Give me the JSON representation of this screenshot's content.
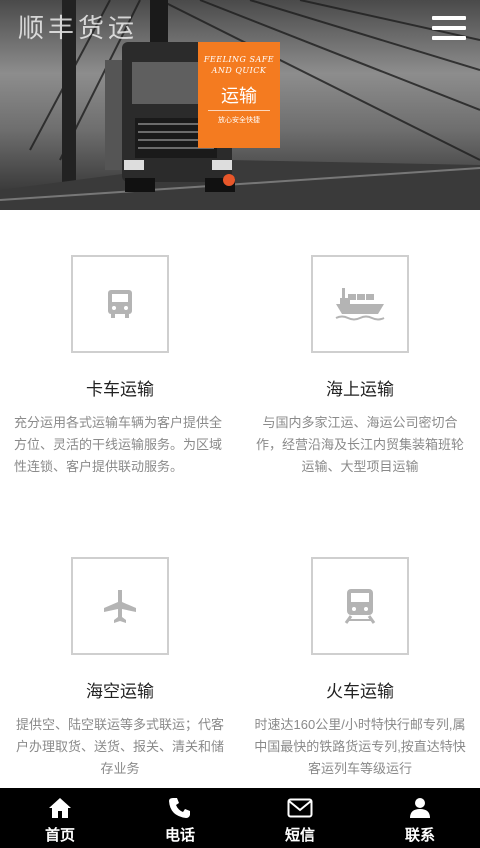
{
  "header": {
    "brand": "顺丰货运",
    "menu_icon": "hamburger-menu-icon"
  },
  "hero": {
    "badge_en": "FEELING SAFE AND QUICK",
    "badge_cn": "运输",
    "badge_sub": "放心安全快捷",
    "accent_color": "#f47b20"
  },
  "services": [
    {
      "title": "卡车运输",
      "icon": "truck-icon",
      "desc": "充分运用各式运输车辆为客户提供全方位、灵活的干线运输服务。为区域性连锁、客户提供联动服务。"
    },
    {
      "title": "海上运输",
      "icon": "ship-icon",
      "desc": "与国内多家江运、海运公司密切合作，经营沿海及长江内贸集装箱班轮运输、大型项目运输"
    },
    {
      "title": "海空运输",
      "icon": "airplane-icon",
      "desc": "提供空、陆空联运等多式联运；代客户办理取货、送货、报关、清关和储存业务"
    },
    {
      "title": "火车运输",
      "icon": "train-icon",
      "desc": "时速达160公里/小时特快行邮专列,属中国最快的铁路货运专列,按直达特快客运列车等级运行"
    }
  ],
  "bottom_nav": [
    {
      "label": "首页",
      "icon": "home-icon"
    },
    {
      "label": "电话",
      "icon": "phone-icon"
    },
    {
      "label": "短信",
      "icon": "envelope-icon"
    },
    {
      "label": "联系",
      "icon": "user-icon"
    }
  ]
}
